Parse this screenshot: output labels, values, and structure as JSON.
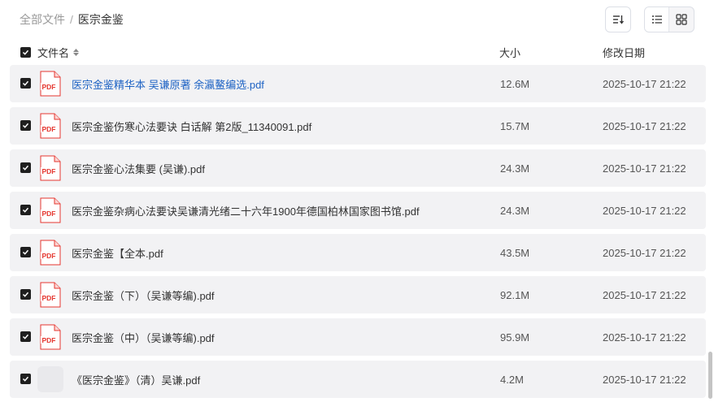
{
  "breadcrumb": {
    "root": "全部文件",
    "separator": "/",
    "current": "医宗金鉴"
  },
  "header": {
    "name": "文件名",
    "size": "大小",
    "modified": "修改日期"
  },
  "files": [
    {
      "name": "医宗金鉴精华本 吴谦原著 余瀛鳌编选.pdf",
      "size": "12.6M",
      "modified": "2025-10-17 21:22",
      "icon": "pdf-icon",
      "checked": true
    },
    {
      "name": "医宗金鉴伤寒心法要诀 白话解 第2版_11340091.pdf",
      "size": "15.7M",
      "modified": "2025-10-17 21:22",
      "icon": "pdf-icon",
      "checked": true
    },
    {
      "name": "医宗金鉴心法集要 (吴谦).pdf",
      "size": "24.3M",
      "modified": "2025-10-17 21:22",
      "icon": "pdf-icon",
      "checked": true
    },
    {
      "name": "医宗金鉴杂病心法要诀吴谦清光绪二十六年1900年德国柏林国家图书馆.pdf",
      "size": "24.3M",
      "modified": "2025-10-17 21:22",
      "icon": "pdf-icon",
      "checked": true
    },
    {
      "name": "医宗金鉴【全本.pdf",
      "size": "43.5M",
      "modified": "2025-10-17 21:22",
      "icon": "pdf-icon",
      "checked": true
    },
    {
      "name": "医宗金鉴（下）（吴谦等编).pdf",
      "size": "92.1M",
      "modified": "2025-10-17 21:22",
      "icon": "pdf-icon",
      "checked": true
    },
    {
      "name": "医宗金鉴（中）（吴谦等编).pdf",
      "size": "95.9M",
      "modified": "2025-10-17 21:22",
      "icon": "pdf-icon",
      "checked": true
    },
    {
      "name": "《医宗金鉴》（清）吴谦.pdf",
      "size": "4.2M",
      "modified": "2025-10-17 21:22",
      "icon": "placeholder-thumbnail",
      "checked": true
    }
  ],
  "colors": {
    "row_bg": "#f2f2f4",
    "link": "#1e63c4",
    "pdf_red": "#e5362f"
  }
}
